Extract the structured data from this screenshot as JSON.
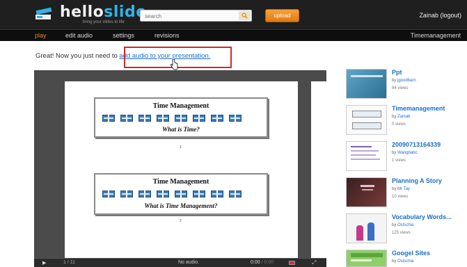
{
  "header": {
    "logo_hello": "hello",
    "logo_slide": "slide",
    "tagline": "bring your slides to life",
    "search_placeholder": "search",
    "upload_label": "upload",
    "user_name": "Zainab",
    "logout_label": "(logout)"
  },
  "nav": {
    "items": [
      {
        "label": "play",
        "active": true
      },
      {
        "label": "edit audio",
        "active": false
      },
      {
        "label": "settings",
        "active": false
      },
      {
        "label": "revisions",
        "active": false
      }
    ],
    "presentation_title": "Timemanagement"
  },
  "message": {
    "prefix": "Great! Now you just need to ",
    "link": "add audio to your presentation."
  },
  "slide": {
    "card1_title": "Time Management",
    "card1_sub": "What is Time?",
    "page1": "1",
    "card2_title": "Time Management",
    "card2_sub": "What is Time Management?",
    "page2": "2"
  },
  "player": {
    "page_indicator": "1 / 11",
    "audio_status": "No audio.",
    "time_current": "0:00",
    "time_total": "0:00"
  },
  "related": [
    {
      "title": "Ppt",
      "by": "by",
      "author": "jgoodbarn",
      "views": "84 views"
    },
    {
      "title": "Timemanagement",
      "by": "by",
      "author": "Zainab",
      "views": "0 views"
    },
    {
      "title": "20090713164339",
      "by": "by",
      "author": "Wangbabc",
      "views": "1 views"
    },
    {
      "title": "Planning A Story",
      "by": "by",
      "author": "Mr Tay",
      "views": "10 views"
    },
    {
      "title": "Vocabulary Words...",
      "by": "by",
      "author": "Ostschia",
      "views": "125 views"
    },
    {
      "title": "Googel Sites",
      "by": "by",
      "author": "Ostschia",
      "views": ""
    }
  ],
  "colors": {
    "accent_blue": "#2eb4e8",
    "upload_orange": "#e8871e",
    "link_blue": "#1a6fd0",
    "highlight_red": "#cc2a2a"
  }
}
